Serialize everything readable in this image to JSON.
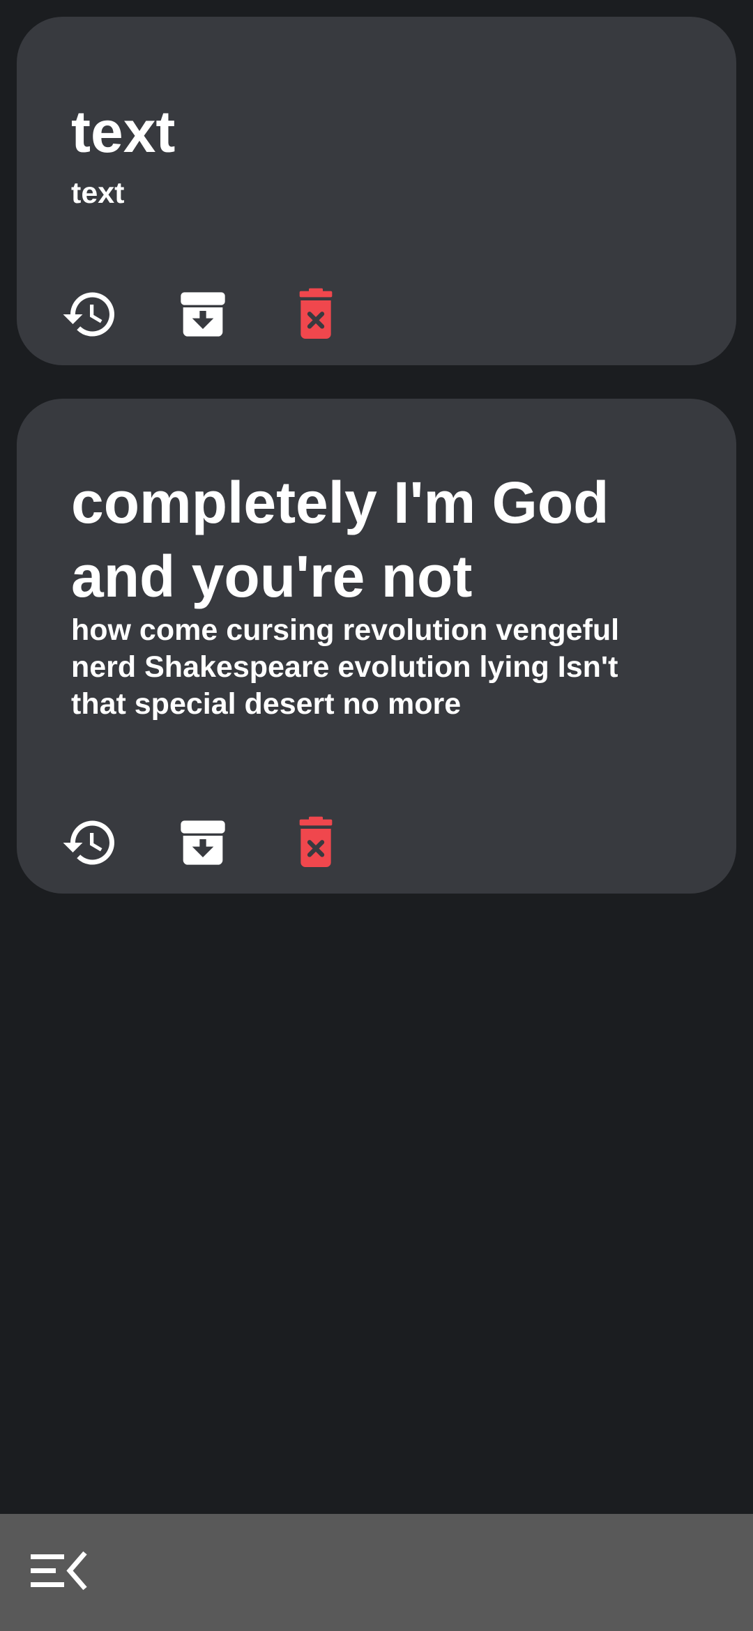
{
  "notes": [
    {
      "title": "text",
      "body": "text"
    },
    {
      "title": "completely I'm God and you're not",
      "body": "how come cursing revolution vengeful nerd Shakespeare evolution lying Isn't that special desert no more"
    }
  ],
  "actions": {
    "restore_icon": "history-icon",
    "archive_icon": "archive-icon",
    "delete_icon": "delete-forever-icon"
  },
  "bottom_bar": {
    "menu_icon": "menu-open-icon"
  },
  "colors": {
    "background": "#1b1d20",
    "card": "#383a3f",
    "text": "#ffffff",
    "delete": "#f0474d",
    "bottom_bar": "#595959"
  }
}
